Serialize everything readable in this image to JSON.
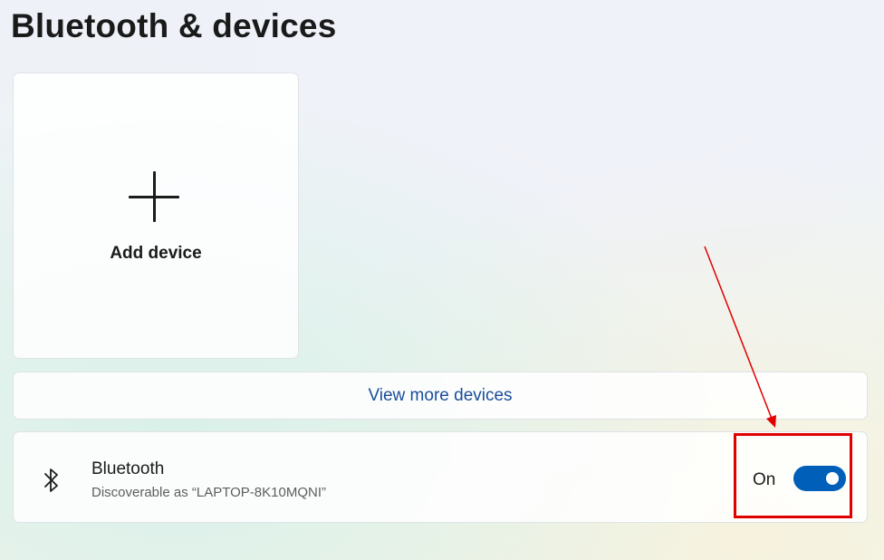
{
  "page": {
    "title": "Bluetooth & devices"
  },
  "add_device": {
    "label": "Add device",
    "icon": "plus-icon"
  },
  "view_more": {
    "label": "View more devices"
  },
  "bluetooth": {
    "icon": "bluetooth-icon",
    "title": "Bluetooth",
    "subtitle": "Discoverable as “LAPTOP-8K10MQNI”",
    "toggle_state_label": "On",
    "toggle_on": true
  },
  "colors": {
    "accent": "#005fb8",
    "link": "#1a4d99",
    "annotation": "#e10000"
  }
}
